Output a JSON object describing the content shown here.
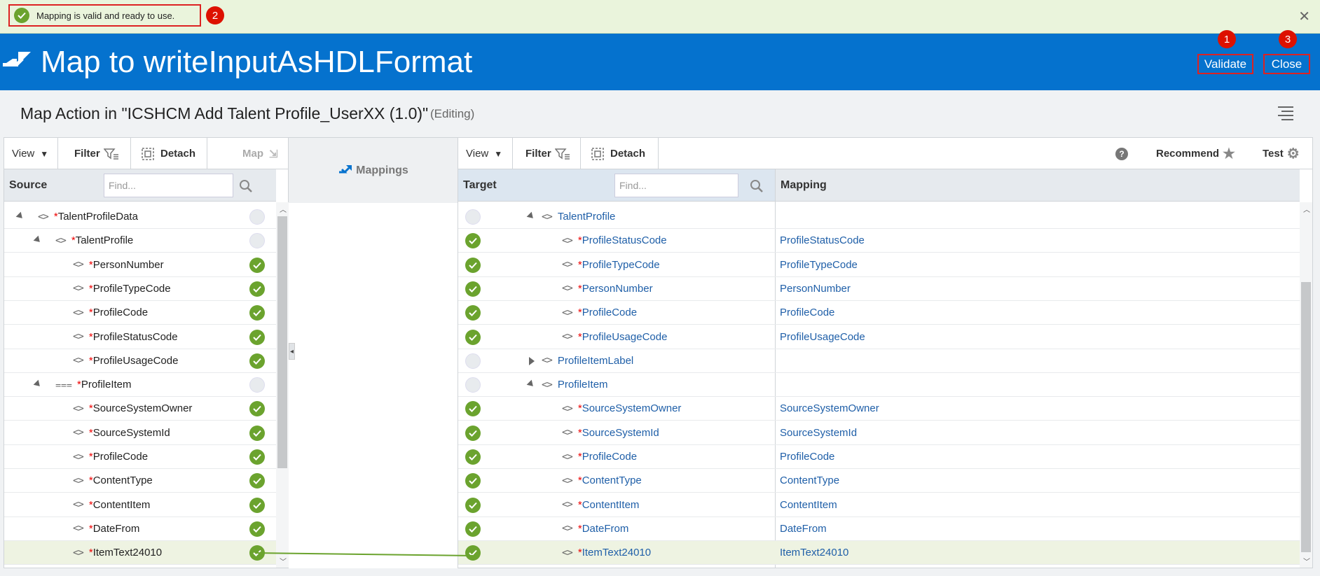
{
  "banner": {
    "message": "Mapping is valid and ready to use.",
    "badge": "2"
  },
  "header": {
    "title": "Map to writeInputAsHDLFormat",
    "validate_label": "Validate",
    "validate_badge": "1",
    "close_label": "Close",
    "close_badge": "3"
  },
  "subheader": {
    "title": "Map Action in \"ICSHCM Add Talent Profile_UserXX (1.0)\"",
    "status": "(Editing)"
  },
  "source_panel": {
    "toolbar": {
      "view": "View",
      "filter": "Filter",
      "detach": "Detach",
      "map": "Map"
    },
    "header": "Source",
    "find_placeholder": "Find...",
    "rows": [
      {
        "name": "TalentProfileData",
        "star": "*",
        "mapped": false
      },
      {
        "name": "TalentProfile",
        "star": "*",
        "mapped": false
      },
      {
        "name": "PersonNumber",
        "star": "*",
        "mapped": true
      },
      {
        "name": "ProfileTypeCode",
        "star": "*",
        "mapped": true
      },
      {
        "name": "ProfileCode",
        "star": "*",
        "mapped": true
      },
      {
        "name": "ProfileStatusCode",
        "star": "*",
        "mapped": true
      },
      {
        "name": "ProfileUsageCode",
        "star": "*",
        "mapped": true
      },
      {
        "name": "ProfileItem",
        "star": "*",
        "mapped": false
      },
      {
        "name": "SourceSystemOwner",
        "star": "*",
        "mapped": true
      },
      {
        "name": "SourceSystemId",
        "star": "*",
        "mapped": true
      },
      {
        "name": "ProfileCode",
        "star": "*",
        "mapped": true
      },
      {
        "name": "ContentType",
        "star": "*",
        "mapped": true
      },
      {
        "name": "ContentItem",
        "star": "*",
        "mapped": true
      },
      {
        "name": "DateFrom",
        "star": "*",
        "mapped": true
      },
      {
        "name": "ItemText24010",
        "star": "*",
        "mapped": true
      }
    ]
  },
  "middle": {
    "label": "Mappings"
  },
  "target_panel": {
    "toolbar": {
      "view": "View",
      "filter": "Filter",
      "detach": "Detach",
      "help": "?",
      "recommend": "Recommend",
      "test": "Test"
    },
    "header_target": "Target",
    "header_mapping": "Mapping",
    "find_placeholder": "Find...",
    "rows": [
      {
        "name": "TalentProfile",
        "star": "",
        "mapping": ""
      },
      {
        "name": "ProfileStatusCode",
        "star": "*",
        "mapping": "ProfileStatusCode"
      },
      {
        "name": "ProfileTypeCode",
        "star": "*",
        "mapping": "ProfileTypeCode"
      },
      {
        "name": "PersonNumber",
        "star": "*",
        "mapping": "PersonNumber"
      },
      {
        "name": "ProfileCode",
        "star": "*",
        "mapping": "ProfileCode"
      },
      {
        "name": "ProfileUsageCode",
        "star": "*",
        "mapping": "ProfileUsageCode"
      },
      {
        "name": "ProfileItemLabel",
        "star": "",
        "mapping": ""
      },
      {
        "name": "ProfileItem",
        "star": "",
        "mapping": ""
      },
      {
        "name": "SourceSystemOwner",
        "star": "*",
        "mapping": "SourceSystemOwner"
      },
      {
        "name": "SourceSystemId",
        "star": "*",
        "mapping": "SourceSystemId"
      },
      {
        "name": "ProfileCode",
        "star": "*",
        "mapping": "ProfileCode"
      },
      {
        "name": "ContentType",
        "star": "*",
        "mapping": "ContentType"
      },
      {
        "name": "ContentItem",
        "star": "*",
        "mapping": "ContentItem"
      },
      {
        "name": "DateFrom",
        "star": "*",
        "mapping": "DateFrom"
      },
      {
        "name": "ItemText24010",
        "star": "*",
        "mapping": "ItemText24010"
      }
    ]
  },
  "colors": {
    "brand": "#0572ce",
    "success": "#6ba32e",
    "highlight": "#d22222"
  }
}
